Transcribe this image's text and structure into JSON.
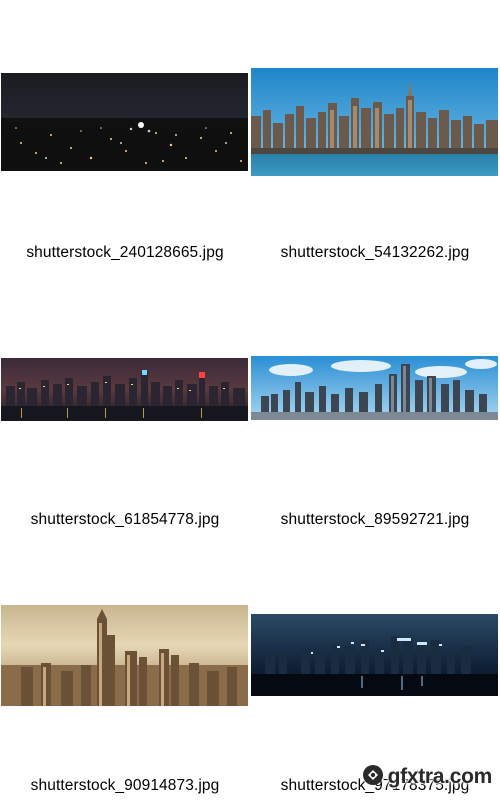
{
  "files": [
    {
      "name": "shutterstock_240128665.jpg",
      "scene": "night-aerial-city"
    },
    {
      "name": "shutterstock_54132262.jpg",
      "scene": "day-manhattan-skyline"
    },
    {
      "name": "shutterstock_61854778.jpg",
      "scene": "night-manhattan-panorama"
    },
    {
      "name": "shutterstock_89592721.jpg",
      "scene": "day-chicago-skyline"
    },
    {
      "name": "shutterstock_90914873.jpg",
      "scene": "sepia-shanghai-aerial"
    },
    {
      "name": "shutterstock_97178375.jpg",
      "scene": "blue-night-skyline"
    }
  ],
  "watermark": {
    "text": "gfxtra.com",
    "icon": "gfxtra-logo-icon",
    "color": "#2a2a2a"
  }
}
